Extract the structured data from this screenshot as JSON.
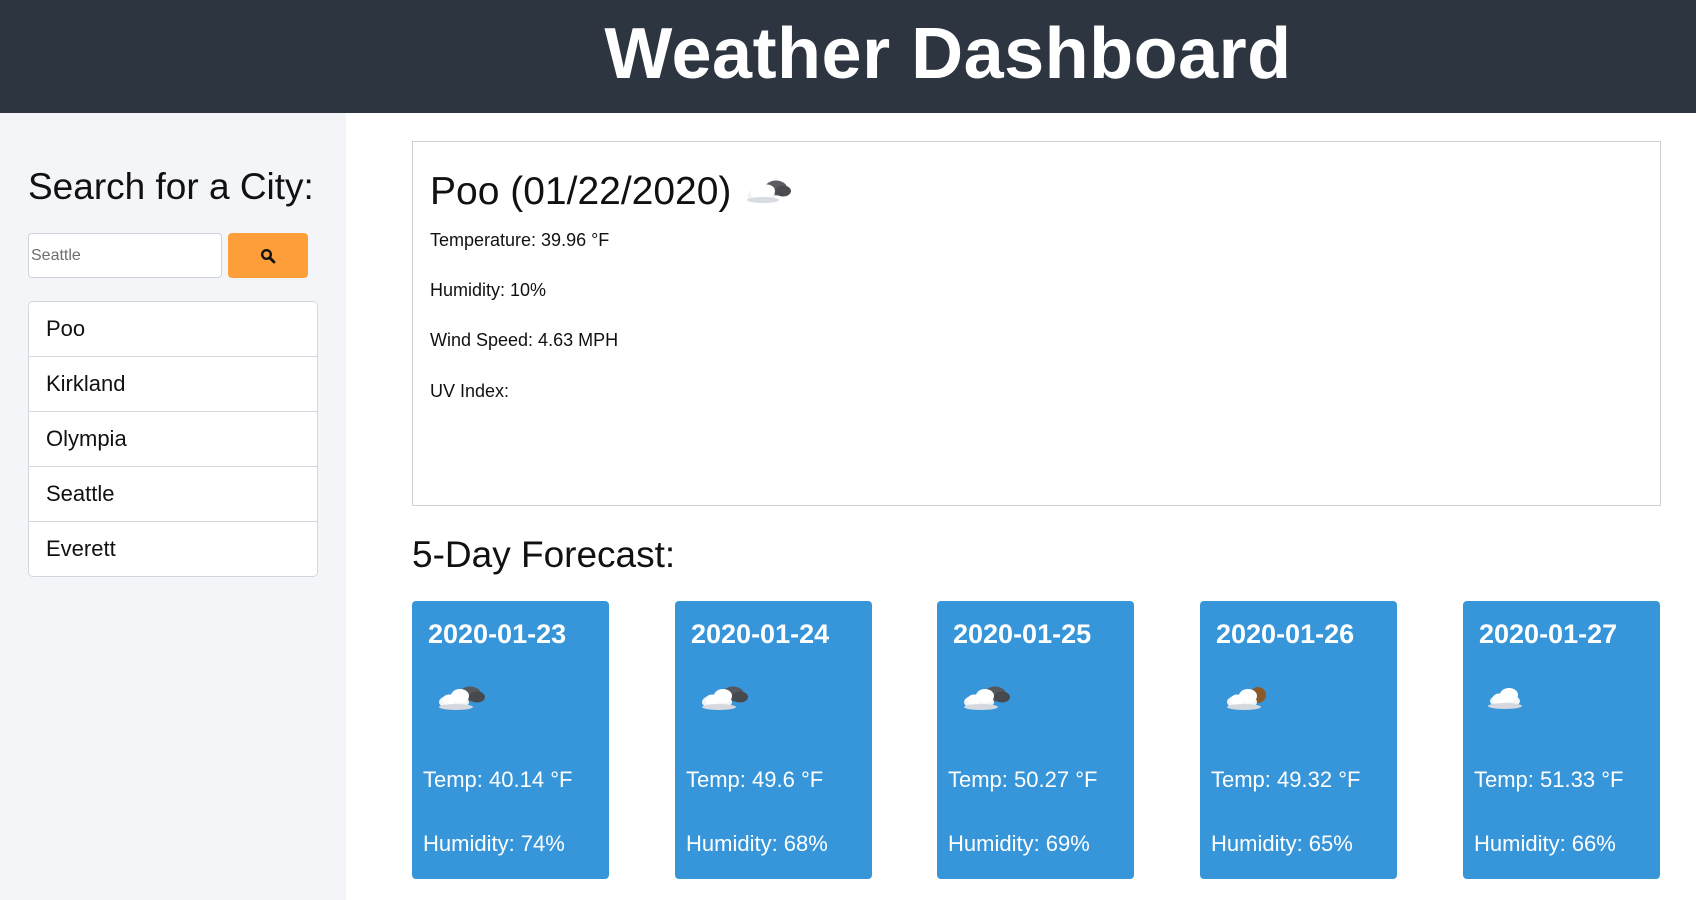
{
  "header": {
    "title": "Weather Dashboard"
  },
  "sidebar": {
    "title": "Search for a City:",
    "search": {
      "placeholder": "Seattle",
      "value": ""
    },
    "search_icon": "search-icon",
    "cities": [
      {
        "label": "Poo"
      },
      {
        "label": "Kirkland"
      },
      {
        "label": "Olympia"
      },
      {
        "label": "Seattle"
      },
      {
        "label": "Everett"
      }
    ]
  },
  "current": {
    "city": "Poo",
    "date": "(01/22/2020)",
    "icon": "partly-cloudy-icon",
    "temperature": "Temperature: 39.96 °F",
    "humidity": "Humidity: 10%",
    "wind": "Wind Speed: 4.63 MPH",
    "uv": "UV Index:"
  },
  "forecast": {
    "title": "5-Day Forecast:",
    "days": [
      {
        "date": "2020-01-23",
        "icon": "broken-clouds-icon",
        "temp": "Temp: 40.14 °F",
        "humidity": "Humidity: 74%"
      },
      {
        "date": "2020-01-24",
        "icon": "broken-clouds-icon",
        "temp": "Temp: 49.6 °F",
        "humidity": "Humidity: 68%"
      },
      {
        "date": "2020-01-25",
        "icon": "broken-clouds-icon",
        "temp": "Temp: 50.27 °F",
        "humidity": "Humidity: 69%"
      },
      {
        "date": "2020-01-26",
        "icon": "partly-cloudy-icon",
        "temp": "Temp: 49.32 °F",
        "humidity": "Humidity: 65%"
      },
      {
        "date": "2020-01-27",
        "icon": "cloud-icon",
        "temp": "Temp: 51.33 °F",
        "humidity": "Humidity: 66%"
      }
    ]
  },
  "colors": {
    "header_bg": "#2d3540",
    "sidebar_bg": "#f4f5f9",
    "search_button": "#fd9e3b",
    "forecast_card": "#3796da"
  }
}
